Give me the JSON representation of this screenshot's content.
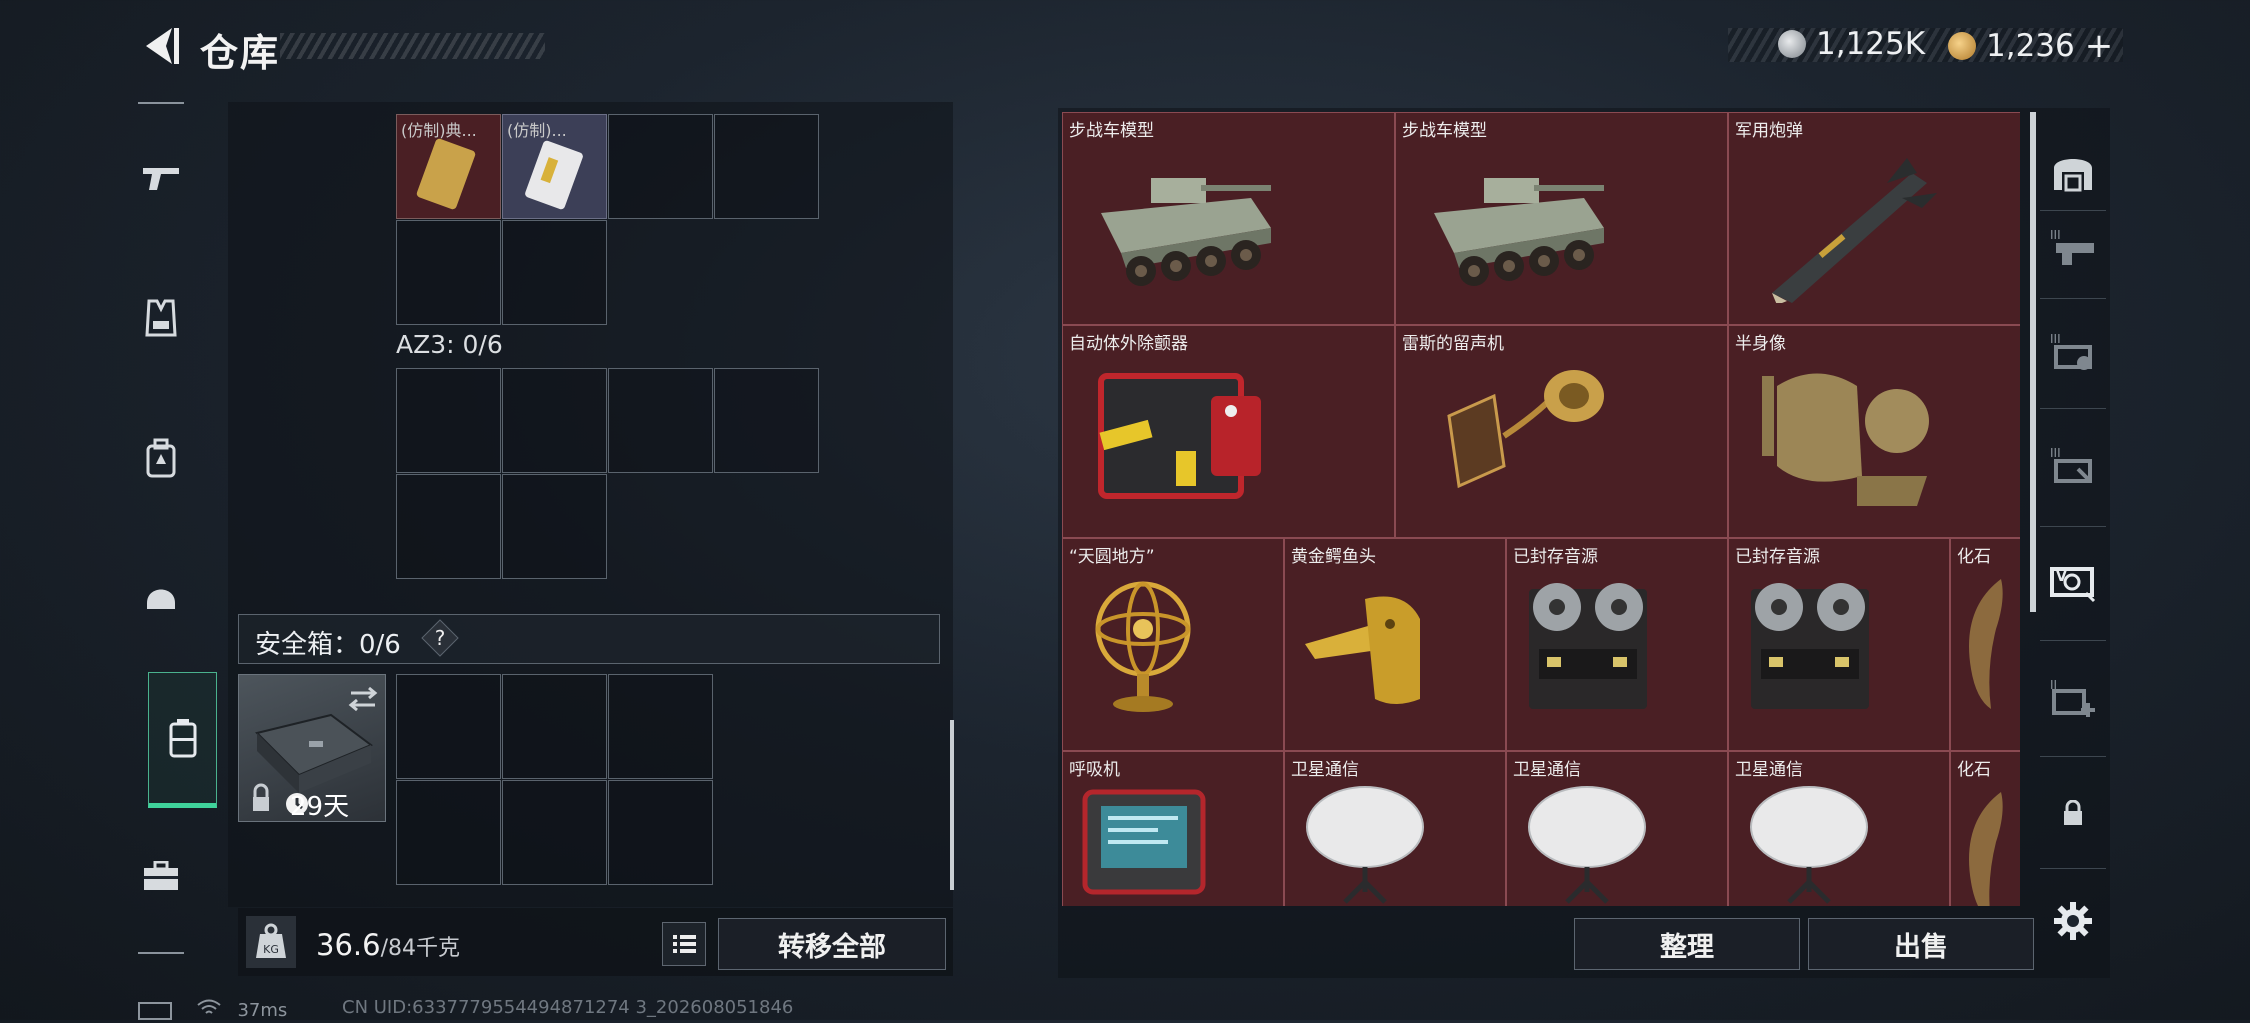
{
  "header": {
    "title": "仓库",
    "silver": "1,125K",
    "gold": "1,236",
    "add": "+"
  },
  "left_nav": [
    "pistol-icon",
    "vest-icon",
    "backpack-icon",
    "helmet-icon",
    "container-icon",
    "briefcase-icon"
  ],
  "storage": {
    "mini_items": [
      "(仿制)典...",
      "(仿制)..."
    ],
    "container_label": "AZ3: 0/6",
    "safe_label": "安全箱：0/6",
    "safe_help": "?",
    "safe_days": "29天",
    "weight": "36.6",
    "weight_cap": "/84千克",
    "transfer_all": "转移全部"
  },
  "market": {
    "items": [
      {
        "name": "步战车模型",
        "art": "ifv"
      },
      {
        "name": "步战车模型",
        "art": "ifv"
      },
      {
        "name": "军用炮弹",
        "art": "missile"
      },
      {
        "name": "自动体外除颤器",
        "art": "aed"
      },
      {
        "name": "雷斯的留声机",
        "art": "gramophone"
      },
      {
        "name": "半身像",
        "art": "bust"
      },
      {
        "name": "“天圆地方”",
        "art": "armillary"
      },
      {
        "name": "黄金鳄鱼头",
        "art": "croc"
      },
      {
        "name": "已封存音源",
        "art": "reel"
      },
      {
        "name": "已封存音源",
        "art": "reel"
      },
      {
        "name": "化石",
        "art": "fossil"
      },
      {
        "name": "呼吸机",
        "art": "ventilator"
      },
      {
        "name": "卫星通信",
        "art": "dish"
      },
      {
        "name": "卫星通信",
        "art": "dish"
      },
      {
        "name": "卫星通信",
        "art": "dish"
      },
      {
        "name": "化石",
        "art": "fossil"
      }
    ],
    "organize": "整理",
    "sell": "出售"
  },
  "status": {
    "ping": "37ms",
    "uid": "CN UID:6337779554494871274 3_202608051846"
  },
  "colors": {
    "tile_bg": "#4a1f24",
    "accent_green": "#3fd39b"
  }
}
